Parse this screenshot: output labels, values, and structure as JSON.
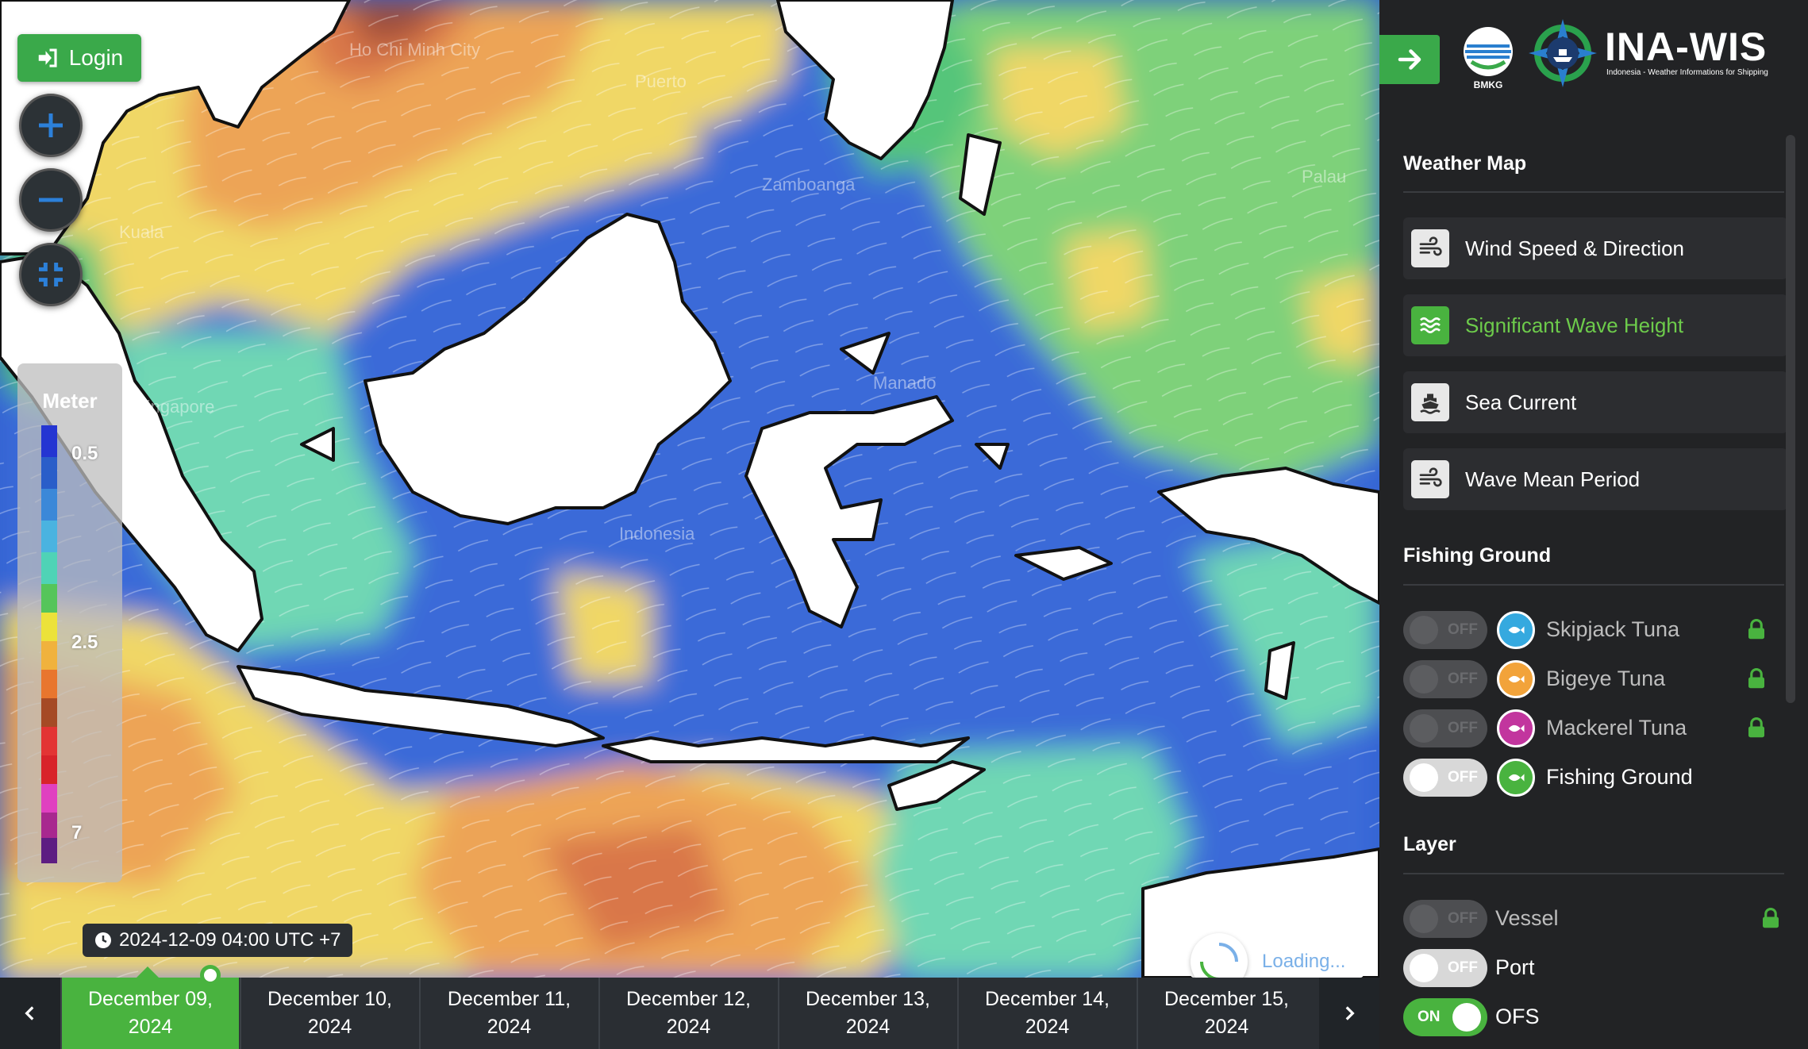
{
  "map": {
    "login_label": "Login",
    "legend": {
      "title": "Meter",
      "ticks": [
        "0.5",
        "2.5",
        "7"
      ]
    },
    "timestamp": "2024-12-09 04:00 UTC +7",
    "loading_text": "Loading...",
    "timeline": {
      "days": [
        [
          "December 09,",
          "2024"
        ],
        [
          "December 10,",
          "2024"
        ],
        [
          "December 11,",
          "2024"
        ],
        [
          "December 12,",
          "2024"
        ],
        [
          "December 13,",
          "2024"
        ],
        [
          "December 14,",
          "2024"
        ],
        [
          "December 15,",
          "2024"
        ]
      ],
      "active_index": 0
    }
  },
  "sidebar": {
    "logo_bmkg": "BMKG",
    "brand": "INA-WIS",
    "brand_sub": "Indonesia - Weather Informations for Shipping",
    "weather_title": "Weather Map",
    "weather_items": [
      {
        "label": "Wind Speed & Direction",
        "icon": "wind-icon",
        "active": false
      },
      {
        "label": "Significant Wave Height",
        "icon": "wave-icon",
        "active": true
      },
      {
        "label": "Sea Current",
        "icon": "ship-icon",
        "active": false
      },
      {
        "label": "Wave Mean Period",
        "icon": "wind-icon",
        "active": false
      }
    ],
    "fishing_title": "Fishing Ground",
    "fishing_items": [
      {
        "label": "Skipjack Tuna",
        "state": "OFF",
        "locked": true,
        "color": "#35a9df"
      },
      {
        "label": "Bigeye Tuna",
        "state": "OFF",
        "locked": true,
        "color": "#f2a33a"
      },
      {
        "label": "Mackerel Tuna",
        "state": "OFF",
        "locked": true,
        "color": "#c2359e"
      },
      {
        "label": "Fishing Ground",
        "state": "OFF",
        "locked": false,
        "color": "#49b33f"
      }
    ],
    "layer_title": "Layer",
    "layer_items": [
      {
        "label": "Vessel",
        "state": "OFF",
        "locked": true
      },
      {
        "label": "Port",
        "state": "OFF",
        "locked": false
      },
      {
        "label": "OFS",
        "state": "ON",
        "locked": false
      }
    ]
  },
  "colors": {
    "accent": "#49b33f",
    "panel": "#222325"
  }
}
